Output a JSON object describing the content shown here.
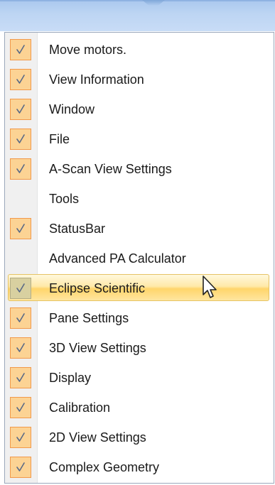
{
  "menu": {
    "items": [
      {
        "label": "Move motors.",
        "checked": true,
        "highlighted": false
      },
      {
        "label": "View Information",
        "checked": true,
        "highlighted": false
      },
      {
        "label": "Window",
        "checked": true,
        "highlighted": false
      },
      {
        "label": "File",
        "checked": true,
        "highlighted": false
      },
      {
        "label": "A-Scan View Settings",
        "checked": true,
        "highlighted": false
      },
      {
        "label": "Tools",
        "checked": false,
        "highlighted": false
      },
      {
        "label": "StatusBar",
        "checked": true,
        "highlighted": false
      },
      {
        "label": "Advanced PA Calculator",
        "checked": false,
        "highlighted": false
      },
      {
        "label": "Eclipse Scientific",
        "checked": true,
        "highlighted": true
      },
      {
        "label": "Pane Settings",
        "checked": true,
        "highlighted": false
      },
      {
        "label": "3D View Settings",
        "checked": true,
        "highlighted": false
      },
      {
        "label": "Display",
        "checked": true,
        "highlighted": false
      },
      {
        "label": "Calibration",
        "checked": true,
        "highlighted": false
      },
      {
        "label": "2D View Settings",
        "checked": true,
        "highlighted": false
      },
      {
        "label": "Complex Geometry",
        "checked": true,
        "highlighted": false
      }
    ]
  },
  "colors": {
    "check_fill": "#fcd394",
    "check_border": "#f2994a",
    "highlight": "#ffd56b",
    "toolbar": "#bdd5f3"
  },
  "icons": {
    "check": "checkmark-icon",
    "cursor": "mouse-pointer-icon"
  }
}
